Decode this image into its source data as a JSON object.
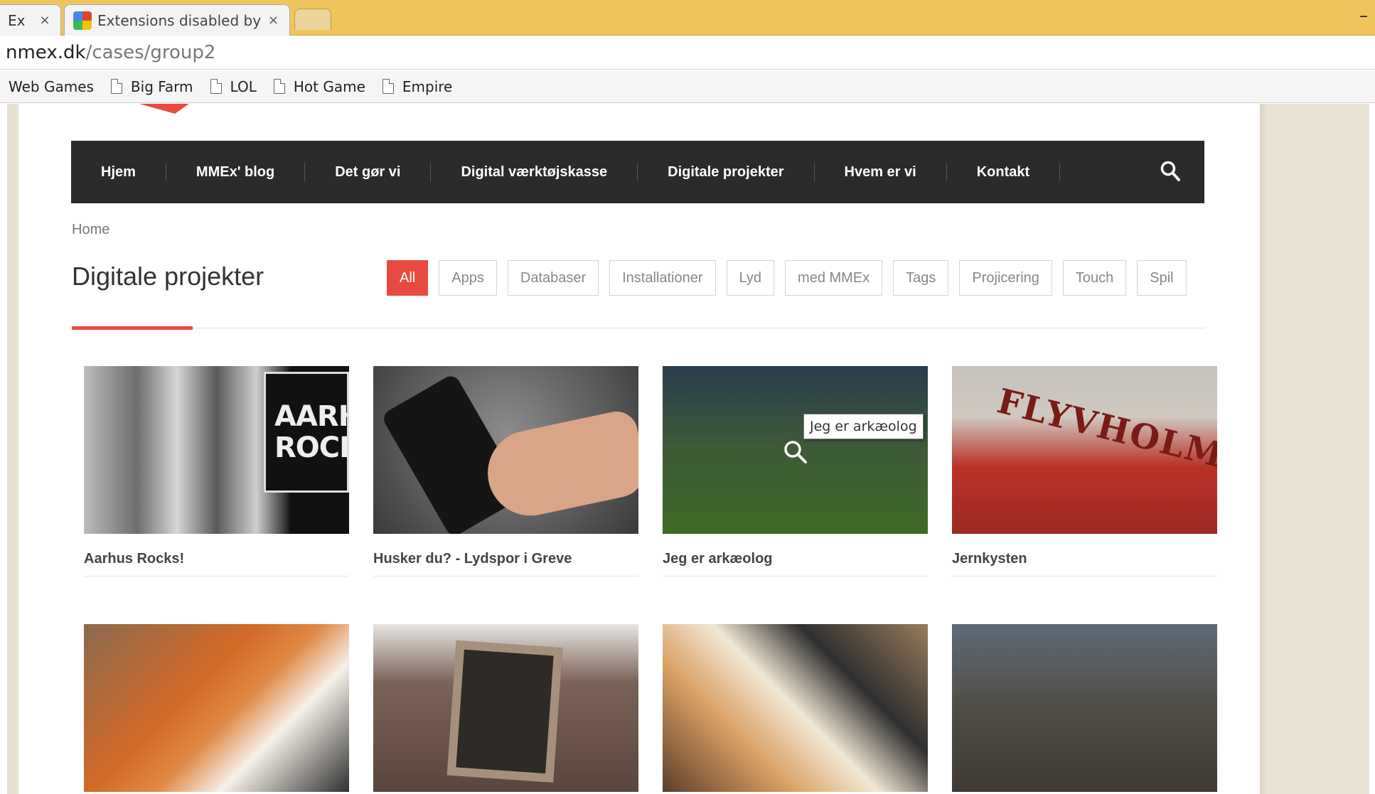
{
  "browser": {
    "tabs": [
      {
        "title": "Ex",
        "close": "×"
      },
      {
        "title": "Extensions disabled by Ch",
        "close": "×"
      }
    ],
    "window_minimize": "–",
    "address": {
      "host": "nmex.dk",
      "path": "/cases/group2"
    },
    "bookmarks": [
      "Web Games",
      "Big Farm",
      "LOL",
      "Hot Game",
      "Empire"
    ]
  },
  "nav": {
    "items": [
      "Hjem",
      "MMEx' blog",
      "Det gør vi",
      "Digital værktøjskasse",
      "Digitale projekter",
      "Hvem er vi",
      "Kontakt"
    ],
    "search_icon": "search-icon"
  },
  "breadcrumb": "Home",
  "page_title": "Digitale projekter",
  "filters": {
    "items": [
      "All",
      "Apps",
      "Databaser",
      "Installationer",
      "Lyd",
      "med MMEx",
      "Tags",
      "Projicering",
      "Touch",
      "Spil"
    ],
    "active": "All"
  },
  "projects": [
    {
      "title": "Aarhus Rocks!",
      "poster_line1": "AARHU",
      "poster_line2": "ROCKS"
    },
    {
      "title": "Husker du? - Lydspor i Greve"
    },
    {
      "title": "Jeg er arkæolog"
    },
    {
      "title": "Jernkysten",
      "ship_text": "FLYVHOLM"
    },
    {
      "title": ""
    },
    {
      "title": ""
    },
    {
      "title": ""
    },
    {
      "title": ""
    }
  ],
  "tooltip": "Jeg er arkæolog",
  "colors": {
    "accent": "#e84a3f",
    "nav_bg": "#2b2b2b",
    "tabbar": "#f0c65c",
    "page_bg": "#e9e4d6"
  }
}
